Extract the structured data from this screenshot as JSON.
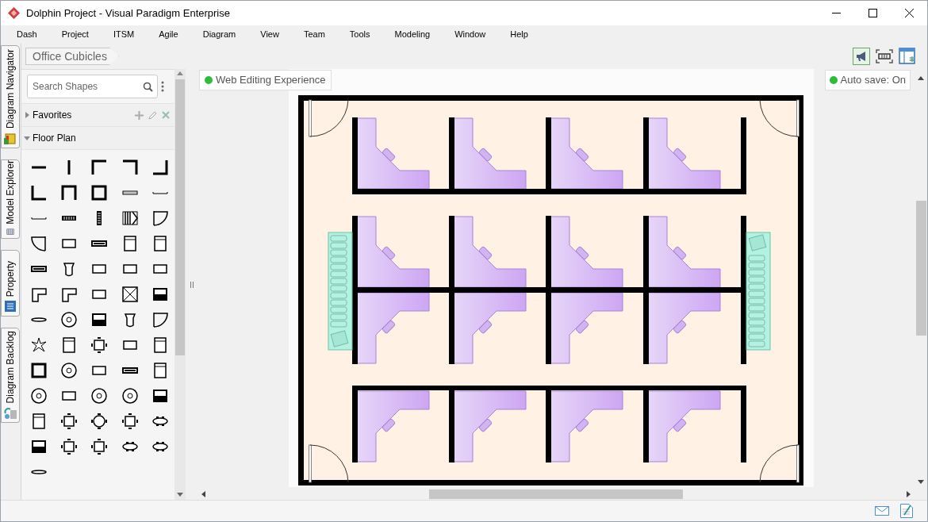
{
  "window": {
    "title": "Dolphin Project - Visual Paradigm Enterprise"
  },
  "menu": [
    "Dash",
    "Project",
    "ITSM",
    "Agile",
    "Diagram",
    "View",
    "Team",
    "Tools",
    "Modeling",
    "Window",
    "Help"
  ],
  "side_tabs": [
    {
      "label": "Diagram Navigator"
    },
    {
      "label": "Model Explorer"
    },
    {
      "label": "Property"
    },
    {
      "label": "Diagram Backlog"
    }
  ],
  "breadcrumb": "Office Cubicles",
  "shape_panel": {
    "search": {
      "placeholder": "Search Shapes"
    },
    "sections": [
      {
        "label": "Favorites",
        "expanded": false
      },
      {
        "label": "Floor Plan",
        "expanded": true
      }
    ]
  },
  "canvas": {
    "web_editing": "Web Editing Experience",
    "auto_save": "Auto save: On"
  }
}
